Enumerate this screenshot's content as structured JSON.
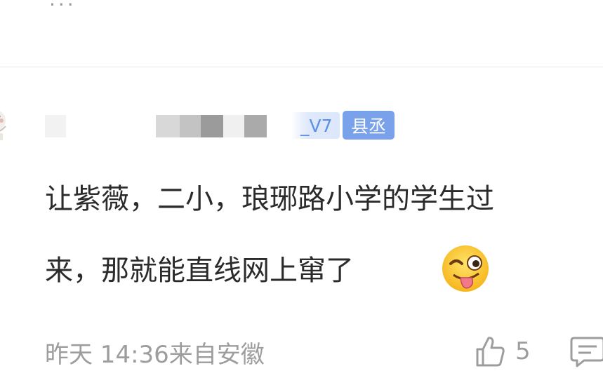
{
  "previous_comment": {
    "tail_text": "..."
  },
  "comment": {
    "level": "_V7",
    "title_badge": "县丞",
    "text_line1": "让紫薇，二小，琅琊路小学的学生过",
    "text_line2": "来，那就能直线网上窜了",
    "emoji": "winking-tongue-out-face",
    "timestamp": "昨天 14:36",
    "location": "来自安徽",
    "like_count": "5"
  },
  "colors": {
    "badge_bg": "#7aa2ea",
    "level_text": "#5d8fe6",
    "meta_text": "#9d9d9d",
    "body_text": "#2b2b2b"
  }
}
